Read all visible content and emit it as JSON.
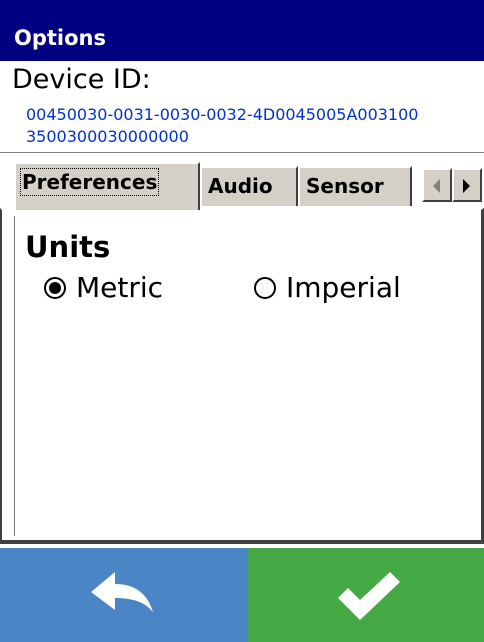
{
  "window": {
    "title": "Options"
  },
  "device": {
    "label": "Device ID:",
    "id": "00450030-0031-0030-0032-4D0045005A0031003500300030000000"
  },
  "tabs": [
    {
      "label": "Preferences",
      "active": true
    },
    {
      "label": "Audio",
      "active": false
    },
    {
      "label": "Sensor",
      "active": false
    }
  ],
  "tab_scroll": {
    "left_icon": "arrow-left-icon",
    "right_icon": "arrow-right-icon"
  },
  "preferences": {
    "units_heading": "Units",
    "options": [
      {
        "label": "Metric",
        "selected": true
      },
      {
        "label": "Imperial",
        "selected": false
      }
    ]
  },
  "bottom_bar": {
    "back_icon": "back-arrow-icon",
    "confirm_icon": "checkmark-icon",
    "back_color": "#4a86c5",
    "confirm_color": "#44a844"
  },
  "colors": {
    "titlebar": "#000080",
    "device_id_text": "#0033cc"
  }
}
